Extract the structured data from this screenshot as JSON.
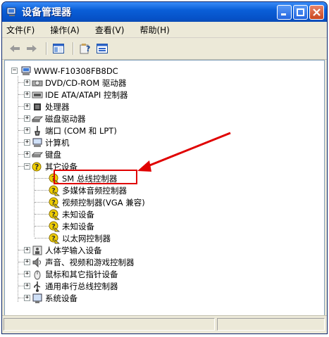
{
  "window": {
    "title": "设备管理器"
  },
  "menu": {
    "file": "文件(F)",
    "action": "操作(A)",
    "view": "查看(V)",
    "help": "帮助(H)"
  },
  "tree": {
    "root": "WWW-F10308FB8DC",
    "items": [
      {
        "label": "DVD/CD-ROM 驱动器",
        "icon": "cd-drive-icon"
      },
      {
        "label": "IDE ATA/ATAPI 控制器",
        "icon": "ide-controller-icon"
      },
      {
        "label": "处理器",
        "icon": "processor-icon"
      },
      {
        "label": "磁盘驱动器",
        "icon": "disk-drive-icon"
      },
      {
        "label": "端口 (COM 和 LPT)",
        "icon": "port-icon"
      },
      {
        "label": "计算机",
        "icon": "computer-icon"
      },
      {
        "label": "键盘",
        "icon": "keyboard-icon"
      },
      {
        "label": "其它设备",
        "icon": "unknown-device-icon"
      }
    ],
    "other_devices": [
      {
        "label": "SM 总线控制器"
      },
      {
        "label": "多媒体音频控制器"
      },
      {
        "label": "视频控制器(VGA 兼容)"
      },
      {
        "label": "未知设备"
      },
      {
        "label": "未知设备"
      },
      {
        "label": "以太网控制器"
      }
    ],
    "items_after": [
      {
        "label": "人体学输入设备",
        "icon": "hid-icon"
      },
      {
        "label": "声音、视频和游戏控制器",
        "icon": "sound-icon"
      },
      {
        "label": "鼠标和其它指针设备",
        "icon": "mouse-icon"
      },
      {
        "label": "通用串行总线控制器",
        "icon": "usb-icon"
      },
      {
        "label": "系统设备",
        "icon": "system-device-icon"
      }
    ]
  },
  "colors": {
    "titlebar": "#0a5fd8",
    "highlight": "#e00000",
    "warning": "#f2d000"
  }
}
